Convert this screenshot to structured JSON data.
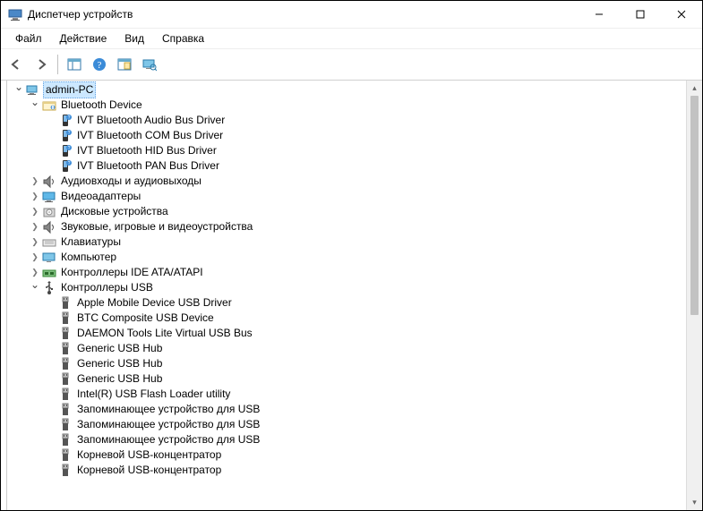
{
  "window": {
    "title": "Диспетчер устройств"
  },
  "menu": {
    "file": "Файл",
    "action": "Действие",
    "view": "Вид",
    "help": "Справка"
  },
  "toolbar_icons": {
    "back": "back-icon",
    "forward": "forward-icon",
    "show_hidden": "panel-icon",
    "help": "help-icon",
    "properties": "props-icon",
    "monitor": "monitor-icon"
  },
  "tree": {
    "root": {
      "label": "admin-PC",
      "icon": "computer",
      "open": true
    },
    "nodes": [
      {
        "label": "Bluetooth Device",
        "icon": "bt-card",
        "open": true,
        "children": [
          {
            "label": "IVT Bluetooth Audio Bus Driver",
            "icon": "bt-dev"
          },
          {
            "label": "IVT Bluetooth COM Bus Driver",
            "icon": "bt-dev"
          },
          {
            "label": "IVT Bluetooth HID Bus Driver",
            "icon": "bt-dev"
          },
          {
            "label": "IVT Bluetooth PAN Bus Driver",
            "icon": "bt-dev"
          }
        ]
      },
      {
        "label": "Аудиовходы и аудиовыходы",
        "icon": "audio",
        "open": false
      },
      {
        "label": "Видеоадаптеры",
        "icon": "display",
        "open": false
      },
      {
        "label": "Дисковые устройства",
        "icon": "disk",
        "open": false
      },
      {
        "label": "Звуковые, игровые и видеоустройства",
        "icon": "audio",
        "open": false
      },
      {
        "label": "Клавиатуры",
        "icon": "keyboard",
        "open": false
      },
      {
        "label": "Компьютер",
        "icon": "monitor",
        "open": false
      },
      {
        "label": "Контроллеры IDE ATA/ATAPI",
        "icon": "ide",
        "open": false
      },
      {
        "label": "Контроллеры USB",
        "icon": "usb-ctl",
        "open": true,
        "children": [
          {
            "label": "Apple Mobile Device USB Driver",
            "icon": "usb"
          },
          {
            "label": "BTC Composite USB Device",
            "icon": "usb"
          },
          {
            "label": "DAEMON Tools Lite Virtual USB Bus",
            "icon": "usb"
          },
          {
            "label": "Generic USB Hub",
            "icon": "usb"
          },
          {
            "label": "Generic USB Hub",
            "icon": "usb"
          },
          {
            "label": "Generic USB Hub",
            "icon": "usb"
          },
          {
            "label": "Intel(R) USB Flash Loader utility",
            "icon": "usb"
          },
          {
            "label": "Запоминающее устройство для USB",
            "icon": "usb"
          },
          {
            "label": "Запоминающее устройство для USB",
            "icon": "usb"
          },
          {
            "label": "Запоминающее устройство для USB",
            "icon": "usb"
          },
          {
            "label": "Корневой USB-концентратор",
            "icon": "usb"
          },
          {
            "label": "Корневой USB-концентратор",
            "icon": "usb"
          }
        ]
      }
    ]
  }
}
